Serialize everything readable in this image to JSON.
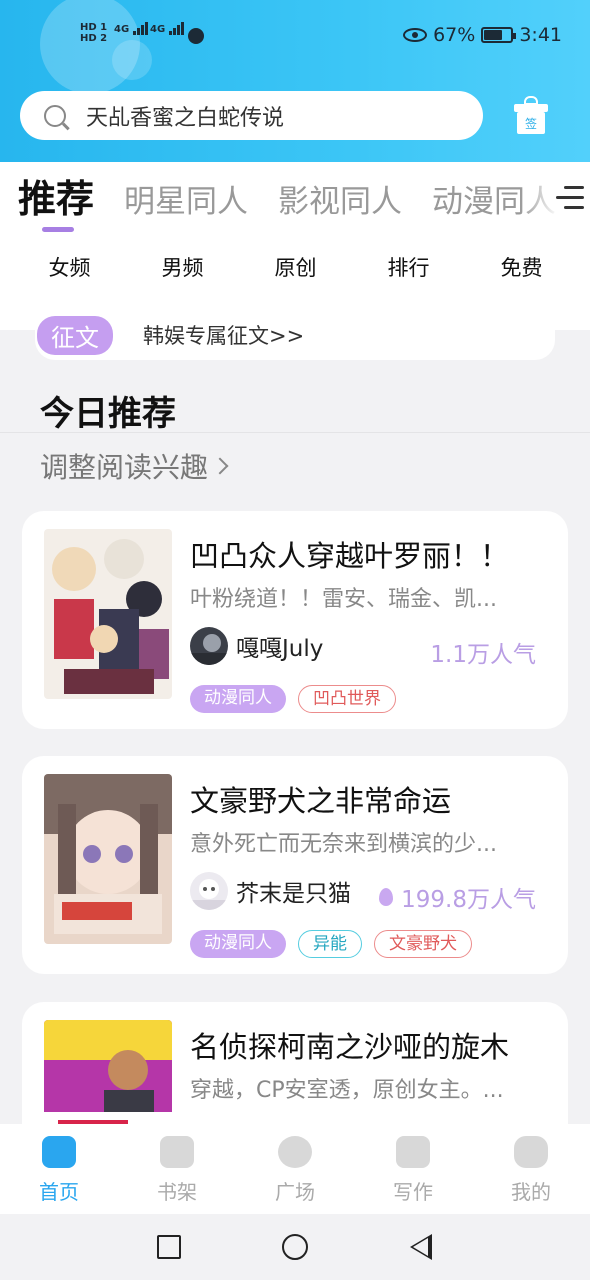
{
  "status_bar": {
    "hd1": "HD 1",
    "hd2": "HD 2",
    "net1": "4G",
    "net2": "4G",
    "battery": "67%",
    "time": "3:41"
  },
  "search": {
    "text": "天乩香蜜之白蛇传说"
  },
  "gift": {
    "label": "签"
  },
  "tabs": [
    {
      "label": "推荐",
      "active": true
    },
    {
      "label": "明星同人",
      "active": false
    },
    {
      "label": "影视同人",
      "active": false
    },
    {
      "label": "动漫同人",
      "active": false
    }
  ],
  "subnav": [
    "女频",
    "男频",
    "原创",
    "排行",
    "免费"
  ],
  "promo": {
    "badge": "征文",
    "text": "韩娱专属征文>>"
  },
  "section": {
    "title": "今日推荐",
    "interest_link": "调整阅读兴趣"
  },
  "books": [
    {
      "title": "凹凸众人穿越叶罗丽！！",
      "desc": "叶粉绕道！！雷安、瑞金、凯...",
      "author": "嘎嘎July",
      "popularity": "1.1万人气",
      "tags": [
        "动漫同人",
        "凹凸世界"
      ]
    },
    {
      "title": "文豪野犬之非常命运",
      "desc": "意外死亡而无奈来到横滨的少...",
      "author": "芥末是只猫",
      "popularity": "199.8万人气",
      "tags": [
        "动漫同人",
        "异能",
        "文豪野犬"
      ]
    },
    {
      "title": "名侦探柯南之沙哑的旋木",
      "desc": "穿越，CP安室透，原创女主。...",
      "author": "",
      "popularity": "",
      "tags": []
    }
  ],
  "bottom_nav": [
    {
      "label": "首页",
      "icon": "home-icon",
      "active": true
    },
    {
      "label": "书架",
      "icon": "bookshelf-icon",
      "active": false
    },
    {
      "label": "广场",
      "icon": "planet-icon",
      "active": false
    },
    {
      "label": "写作",
      "icon": "pen-icon",
      "active": false
    },
    {
      "label": "我的",
      "icon": "chat-bubble-icon",
      "active": false
    }
  ],
  "colors": {
    "header": "#3cc6f6",
    "accent_purple": "#c9a6f2",
    "nav_active": "#2aa6ef"
  }
}
